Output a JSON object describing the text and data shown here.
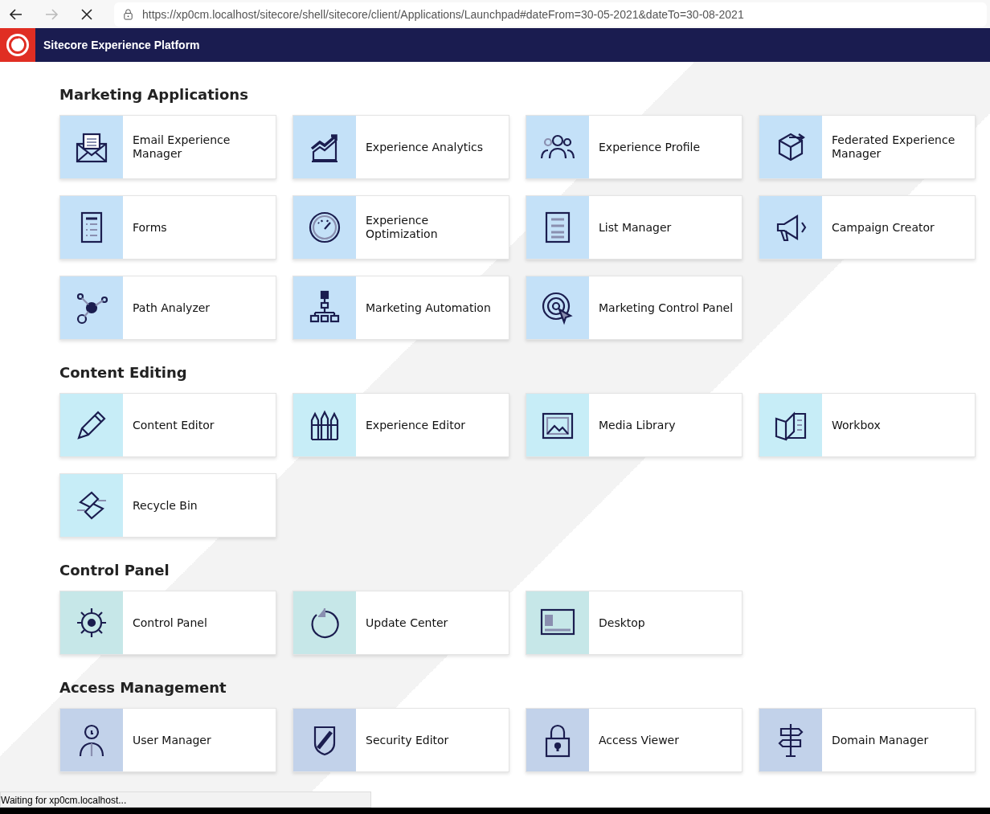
{
  "browser": {
    "url": "https://xp0cm.localhost/sitecore/shell/sitecore/client/Applications/Launchpad#dateFrom=30-05-2021&dateTo=30-08-2021",
    "status": "Waiting for xp0cm.localhost..."
  },
  "header": {
    "title": "Sitecore Experience Platform"
  },
  "sections": [
    {
      "title": "Marketing Applications",
      "color": "#c4e1f8",
      "tiles": [
        "Email Experience Manager",
        "Experience Analytics",
        "Experience Profile",
        "Federated Experience Manager",
        "Forms",
        "Experience Optimization",
        "List Manager",
        "Campaign Creator",
        "Path Analyzer",
        "Marketing Automation",
        "Marketing Control Panel"
      ]
    },
    {
      "title": "Content Editing",
      "color": "#c7edf7",
      "tiles": [
        "Content Editor",
        "Experience Editor",
        "Media Library",
        "Workbox",
        "Recycle Bin"
      ]
    },
    {
      "title": "Control Panel",
      "color": "#c6e7e8",
      "tiles": [
        "Control Panel",
        "Update Center",
        "Desktop"
      ]
    },
    {
      "title": "Access Management",
      "color": "#c2d2ea",
      "tiles": [
        "User Manager",
        "Security Editor",
        "Access Viewer",
        "Domain Manager"
      ]
    }
  ]
}
